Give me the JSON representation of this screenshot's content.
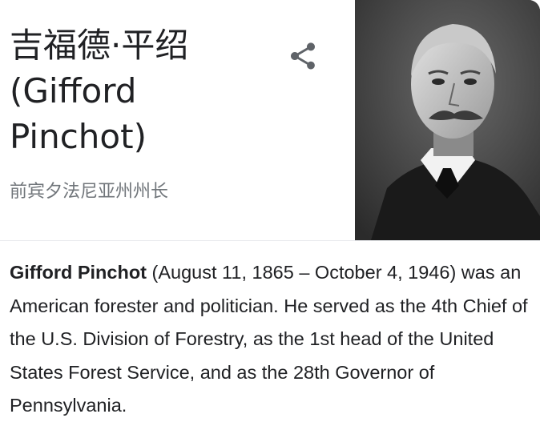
{
  "entity": {
    "title": "吉福德·平绍 (Gifford Pinchot)",
    "subtitle": "前宾夕法尼亚州州长"
  },
  "actions": {
    "share_icon": "share-icon"
  },
  "photo": {
    "alt": "Gifford Pinchot"
  },
  "description": {
    "name": "Gifford Pinchot",
    "text": " (August 11, 1865 – October 4, 1946) was an American forester and politician. He served as the 4th Chief of the U.S. Division of Forestry, as the 1st head of the United States Forest Service, and as the 28th Governor of Pennsylvania."
  }
}
